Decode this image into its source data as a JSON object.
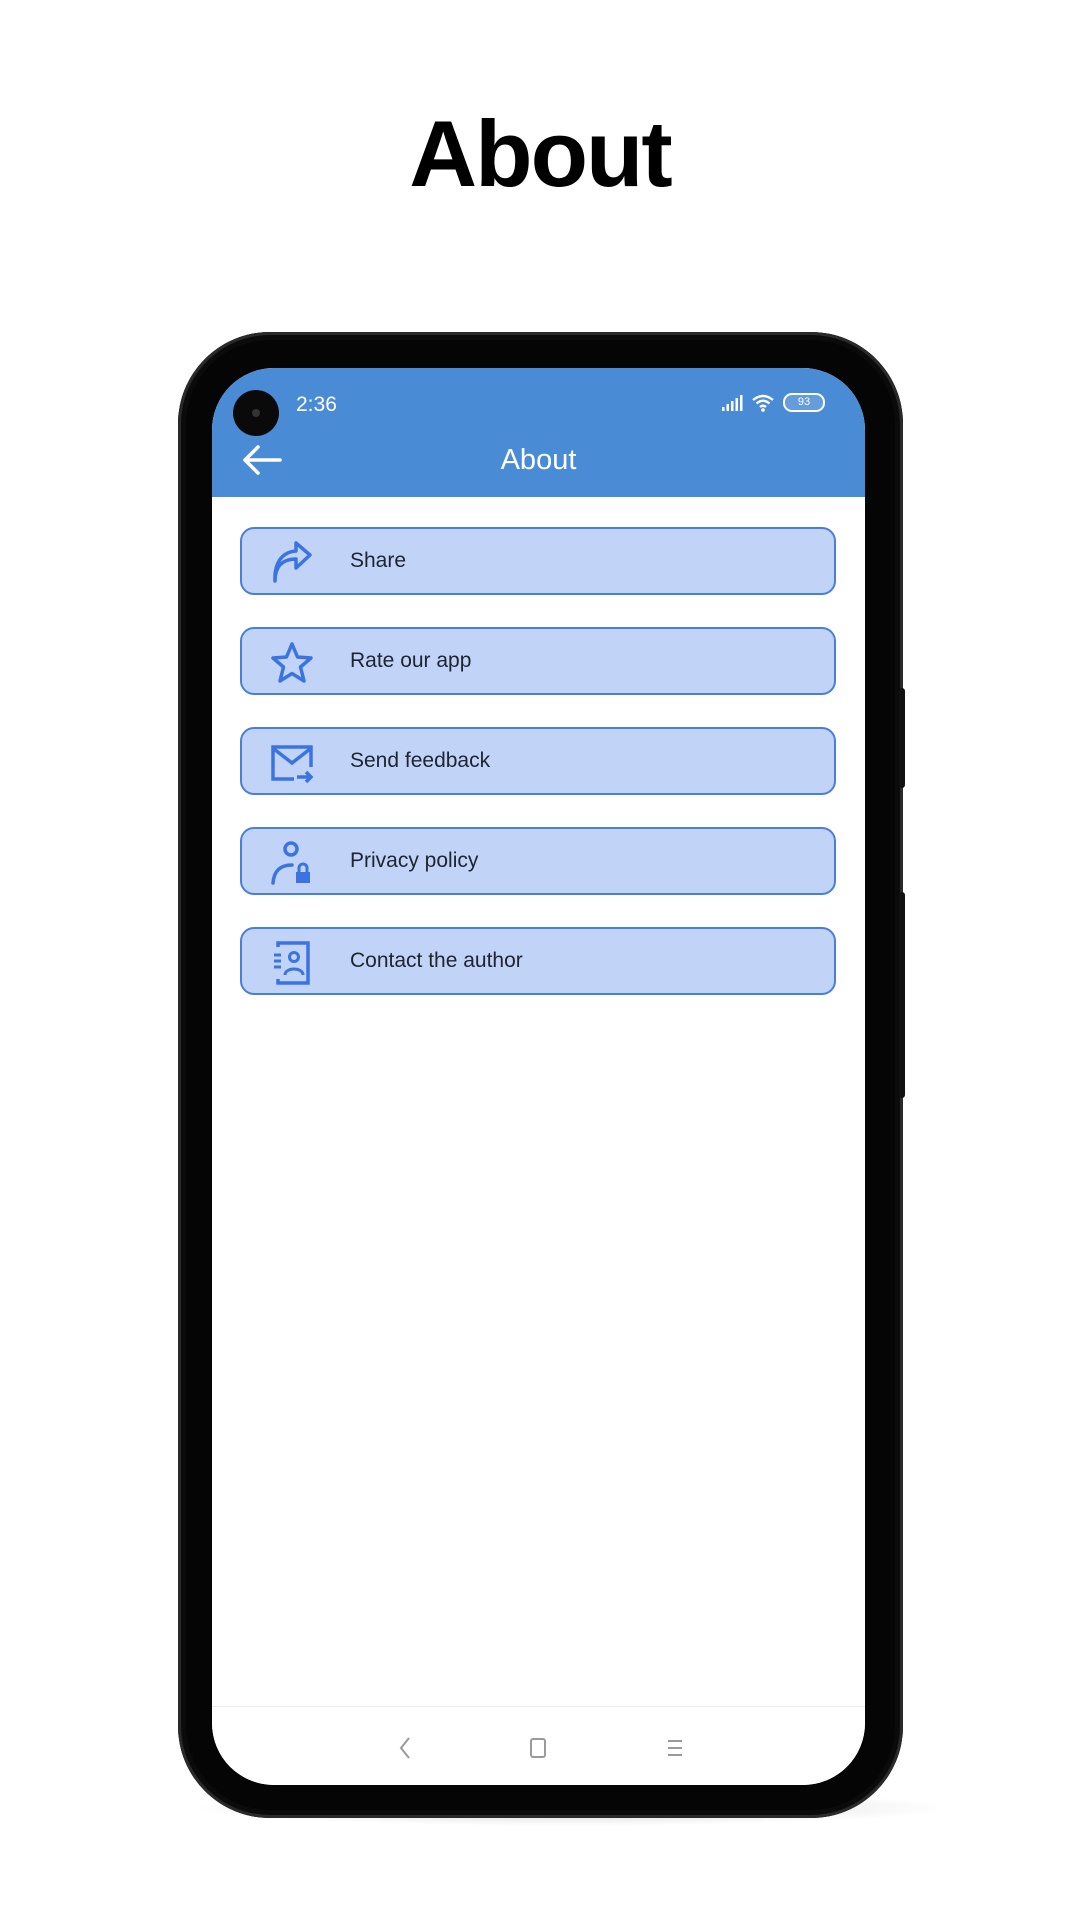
{
  "promo": {
    "title": "About"
  },
  "status_bar": {
    "time": "2:36",
    "battery": "93",
    "icons": [
      "signal-icon",
      "wifi-icon",
      "battery-icon"
    ]
  },
  "app_bar": {
    "title": "About",
    "back_icon": "arrow-left-icon"
  },
  "menu": {
    "items": [
      {
        "label": "Share",
        "icon": "share-icon"
      },
      {
        "label": "Rate our app",
        "icon": "star-icon"
      },
      {
        "label": "Send feedback",
        "icon": "mail-send-icon"
      },
      {
        "label": "Privacy policy",
        "icon": "person-lock-icon"
      },
      {
        "label": "Contact the author",
        "icon": "contact-card-icon"
      }
    ]
  },
  "nav_bar": {
    "buttons": [
      "back",
      "home",
      "recents"
    ]
  },
  "colors": {
    "app_bar": "#4a8bd6",
    "item_bg": "#c1d4f8",
    "item_border": "#4a7fd9",
    "icon": "#3b74e0"
  }
}
